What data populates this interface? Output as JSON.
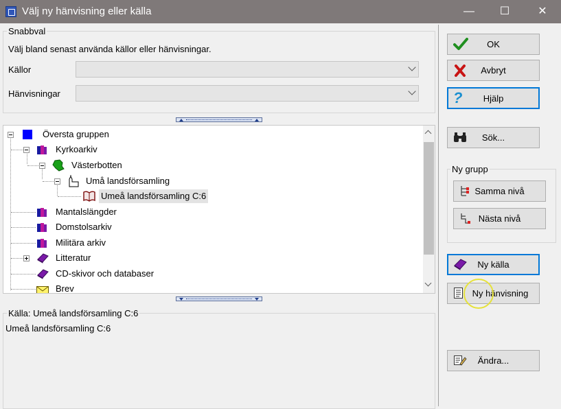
{
  "window": {
    "title": "Välj ny hänvisning eller källa",
    "minimize": "—",
    "maximize": "☐",
    "close": "✕"
  },
  "snabbval": {
    "legend": "Snabbval",
    "description": "Välj bland senast använda källor eller hänvisningar.",
    "kallor_label": "Källor",
    "kallor_value": "",
    "hanvisningar_label": "Hänvisningar",
    "hanvisningar_value": ""
  },
  "tree": {
    "nodes": [
      {
        "label": "Översta gruppen",
        "icon": "blue-square-icon"
      },
      {
        "label": "Kyrkoarkiv",
        "icon": "books-icon"
      },
      {
        "label": "Västerbotten",
        "icon": "green-region-icon"
      },
      {
        "label": "Umå landsförsamling",
        "icon": "church-icon"
      },
      {
        "label": "Umeå landsförsamling C:6",
        "icon": "open-book-icon"
      },
      {
        "label": "Mantalslängder",
        "icon": "books-icon"
      },
      {
        "label": "Domstolsarkiv",
        "icon": "books-icon"
      },
      {
        "label": "Militära arkiv",
        "icon": "books-icon"
      },
      {
        "label": "Litteratur",
        "icon": "purple-book-icon"
      },
      {
        "label": "CD-skivor och databaser",
        "icon": "purple-book-icon"
      },
      {
        "label": "Brev",
        "icon": "envelope-icon"
      }
    ]
  },
  "info": {
    "legend": "Källa: Umeå landsförsamling C:6",
    "text": "Umeå landsförsamling C:6"
  },
  "buttons": {
    "ok": "OK",
    "cancel": "Avbryt",
    "help": "Hjälp",
    "search": "Sök...",
    "ny_grupp_legend": "Ny grupp",
    "same_level": "Samma nivå",
    "next_level": "Nästa nivå",
    "new_source": "Ny källa",
    "new_reference": "Ny hänvisning",
    "edit": "Ändra..."
  },
  "colors": {
    "titlebar": "#7f7979",
    "focus": "#0078d7",
    "highlight": "#e6e23a"
  }
}
